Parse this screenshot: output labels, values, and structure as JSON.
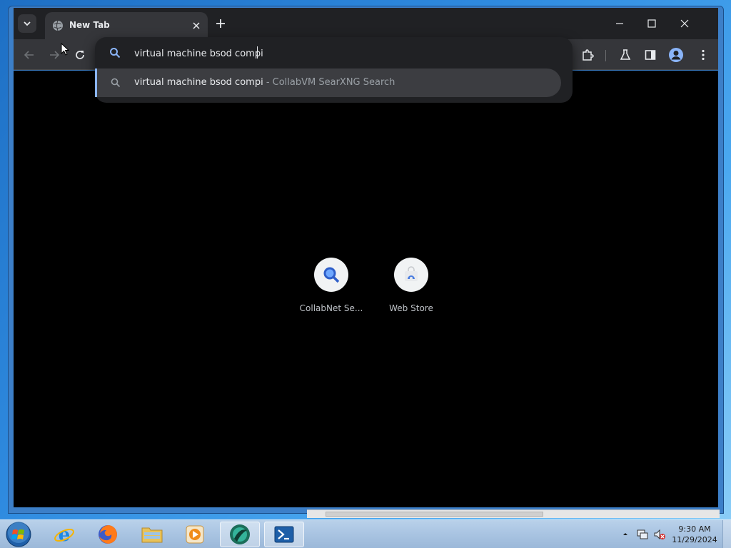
{
  "browser": {
    "tab": {
      "title": "New Tab"
    },
    "omnibox": {
      "value": "virtual machine bsod compi",
      "suggestion": {
        "query": "virtual machine bsod compi",
        "engine": " - CollabVM SearXNG Search"
      }
    },
    "shortcuts": [
      {
        "label": "CollabNet Se...",
        "icon": "search-magnifier-icon"
      },
      {
        "label": "Web Store",
        "icon": "web-store-icon"
      }
    ]
  },
  "taskbar": {
    "apps": [
      "start-orb",
      "internet-explorer",
      "firefox",
      "file-explorer",
      "media-player",
      "browser",
      "powershell"
    ],
    "clock": {
      "time": "9:30 AM",
      "date": "11/29/2024"
    }
  },
  "colors": {
    "accent": "#8ab4f8",
    "toolbar": "#35363a",
    "titlebar": "#202124",
    "content": "#000000"
  }
}
